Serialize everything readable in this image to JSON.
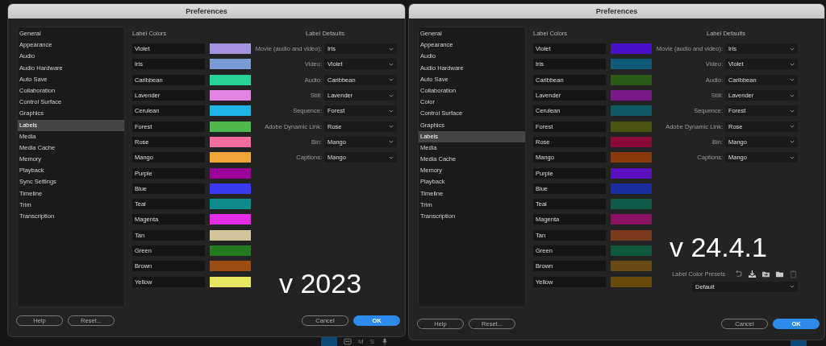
{
  "windows": [
    {
      "title": "Preferences",
      "overlay": "v 2023",
      "sidebar": [
        {
          "label": "General",
          "selected": false
        },
        {
          "label": "Appearance",
          "selected": false
        },
        {
          "label": "Audio",
          "selected": false
        },
        {
          "label": "Audio Hardware",
          "selected": false
        },
        {
          "label": "Auto Save",
          "selected": false
        },
        {
          "label": "Collaboration",
          "selected": false
        },
        {
          "label": "Control Surface",
          "selected": false
        },
        {
          "label": "Graphics",
          "selected": false
        },
        {
          "label": "Labels",
          "selected": true
        },
        {
          "label": "Media",
          "selected": false
        },
        {
          "label": "Media Cache",
          "selected": false
        },
        {
          "label": "Memory",
          "selected": false
        },
        {
          "label": "Playback",
          "selected": false
        },
        {
          "label": "Sync Settings",
          "selected": false
        },
        {
          "label": "Timeline",
          "selected": false
        },
        {
          "label": "Trim",
          "selected": false
        },
        {
          "label": "Transcription",
          "selected": false
        }
      ],
      "label_colors_heading": "Label Colors",
      "label_colors": [
        {
          "name": "Violet",
          "color": "#a593e0"
        },
        {
          "name": "Iris",
          "color": "#7a9ad6"
        },
        {
          "name": "Caribbean",
          "color": "#29d398"
        },
        {
          "name": "Lavender",
          "color": "#e384e3"
        },
        {
          "name": "Cerulean",
          "color": "#1fb5e6"
        },
        {
          "name": "Forest",
          "color": "#4fb84f"
        },
        {
          "name": "Rose",
          "color": "#f46ca0"
        },
        {
          "name": "Mango",
          "color": "#f0a43a"
        },
        {
          "name": "Purple",
          "color": "#9b009b"
        },
        {
          "name": "Blue",
          "color": "#3a3af0"
        },
        {
          "name": "Teal",
          "color": "#0f8a8a"
        },
        {
          "name": "Magenta",
          "color": "#e22ee8"
        },
        {
          "name": "Tan",
          "color": "#d4c49c"
        },
        {
          "name": "Green",
          "color": "#237a23"
        },
        {
          "name": "Brown",
          "color": "#9c4e12"
        },
        {
          "name": "Yellow",
          "color": "#e6e660"
        }
      ],
      "label_defaults_heading": "Label Defaults",
      "label_defaults": [
        {
          "label": "Movie (audio and video):",
          "value": "Iris"
        },
        {
          "label": "Video:",
          "value": "Violet"
        },
        {
          "label": "Audio:",
          "value": "Caribbean"
        },
        {
          "label": "Still:",
          "value": "Lavender"
        },
        {
          "label": "Sequence:",
          "value": "Forest"
        },
        {
          "label": "Adobe Dynamic Link:",
          "value": "Rose"
        },
        {
          "label": "Bin:",
          "value": "Mango"
        },
        {
          "label": "Captions:",
          "value": "Mango"
        }
      ],
      "buttons": {
        "help": "Help",
        "reset": "Reset...",
        "cancel": "Cancel",
        "ok": "OK"
      }
    },
    {
      "title": "Preferences",
      "overlay": "v 24.4.1",
      "sidebar": [
        {
          "label": "General",
          "selected": false
        },
        {
          "label": "Appearance",
          "selected": false
        },
        {
          "label": "Audio",
          "selected": false
        },
        {
          "label": "Audio Hardware",
          "selected": false
        },
        {
          "label": "Auto Save",
          "selected": false
        },
        {
          "label": "Collaboration",
          "selected": false
        },
        {
          "label": "Color",
          "selected": false
        },
        {
          "label": "Control Surface",
          "selected": false
        },
        {
          "label": "Graphics",
          "selected": false
        },
        {
          "label": "Labels",
          "selected": true
        },
        {
          "label": "Media",
          "selected": false
        },
        {
          "label": "Media Cache",
          "selected": false
        },
        {
          "label": "Memory",
          "selected": false
        },
        {
          "label": "Playback",
          "selected": false
        },
        {
          "label": "Timeline",
          "selected": false
        },
        {
          "label": "Trim",
          "selected": false
        },
        {
          "label": "Transcription",
          "selected": false
        }
      ],
      "label_colors_heading": "Label Colors",
      "label_colors": [
        {
          "name": "Violet",
          "color": "#4a12c8"
        },
        {
          "name": "Iris",
          "color": "#0f5a78"
        },
        {
          "name": "Caribbean",
          "color": "#2a5a14"
        },
        {
          "name": "Lavender",
          "color": "#7a1a8a"
        },
        {
          "name": "Cerulean",
          "color": "#0f5a66"
        },
        {
          "name": "Forest",
          "color": "#4a5410"
        },
        {
          "name": "Rose",
          "color": "#8a0a3c"
        },
        {
          "name": "Mango",
          "color": "#8a3a0a"
        },
        {
          "name": "Purple",
          "color": "#5a10c0"
        },
        {
          "name": "Blue",
          "color": "#1a2ea0"
        },
        {
          "name": "Teal",
          "color": "#0f5a4a"
        },
        {
          "name": "Magenta",
          "color": "#8a1260"
        },
        {
          "name": "Tan",
          "color": "#7a3a1a"
        },
        {
          "name": "Green",
          "color": "#0f5a3a"
        },
        {
          "name": "Brown",
          "color": "#6a4a14"
        },
        {
          "name": "Yellow",
          "color": "#6a4a0a"
        }
      ],
      "label_defaults_heading": "Label Defaults",
      "label_defaults": [
        {
          "label": "Movie (audio and video):",
          "value": "Iris"
        },
        {
          "label": "Video:",
          "value": "Violet"
        },
        {
          "label": "Audio:",
          "value": "Caribbean"
        },
        {
          "label": "Still:",
          "value": "Lavender"
        },
        {
          "label": "Sequence:",
          "value": "Forest"
        },
        {
          "label": "Adobe Dynamic Link:",
          "value": "Rose"
        },
        {
          "label": "Bin:",
          "value": "Mango"
        },
        {
          "label": "Captions:",
          "value": "Mango"
        }
      ],
      "presets": {
        "label": "Label Color Presets",
        "value": "Default"
      },
      "buttons": {
        "help": "Help",
        "reset": "Reset...",
        "cancel": "Cancel",
        "ok": "OK"
      }
    }
  ],
  "taskbar_letters": [
    "M",
    "S"
  ]
}
